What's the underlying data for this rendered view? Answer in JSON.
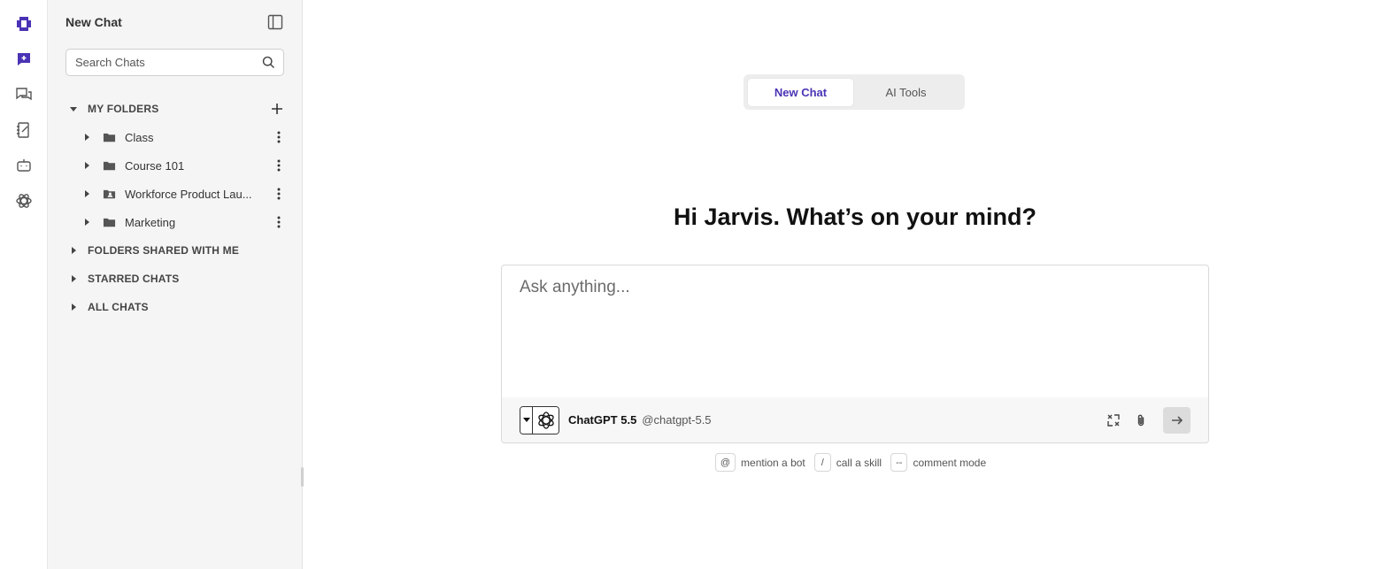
{
  "rail": {
    "items": [
      {
        "name": "logo-icon"
      },
      {
        "name": "new-chat-icon"
      },
      {
        "name": "chats-icon"
      },
      {
        "name": "notebook-icon"
      },
      {
        "name": "bots-icon"
      },
      {
        "name": "science-icon"
      }
    ],
    "accent": "#4a33b5"
  },
  "sidebar": {
    "title": "New Chat",
    "search_placeholder": "Search Chats",
    "my_folders_label": "MY FOLDERS",
    "folders": [
      {
        "label": "Class",
        "icon": "folder-icon"
      },
      {
        "label": "Course 101",
        "icon": "folder-icon"
      },
      {
        "label": "Workforce Product Lau...",
        "icon": "shared-folder-icon"
      },
      {
        "label": "Marketing",
        "icon": "folder-icon"
      }
    ],
    "sections": [
      {
        "label": "FOLDERS SHARED WITH ME"
      },
      {
        "label": "STARRED CHATS"
      },
      {
        "label": "ALL CHATS"
      }
    ]
  },
  "main": {
    "tabs": [
      {
        "label": "New Chat",
        "active": true
      },
      {
        "label": "AI Tools",
        "active": false
      }
    ],
    "greeting": "Hi Jarvis. What’s on your mind?",
    "composer": {
      "placeholder": "Ask anything...",
      "bot_name": "ChatGPT 5.5",
      "bot_handle": "@chatgpt-5.5"
    },
    "hints": [
      {
        "key": "@",
        "label": "mention a bot"
      },
      {
        "key": "/",
        "label": "call a skill"
      },
      {
        "key": "--",
        "label": "comment mode"
      }
    ]
  }
}
